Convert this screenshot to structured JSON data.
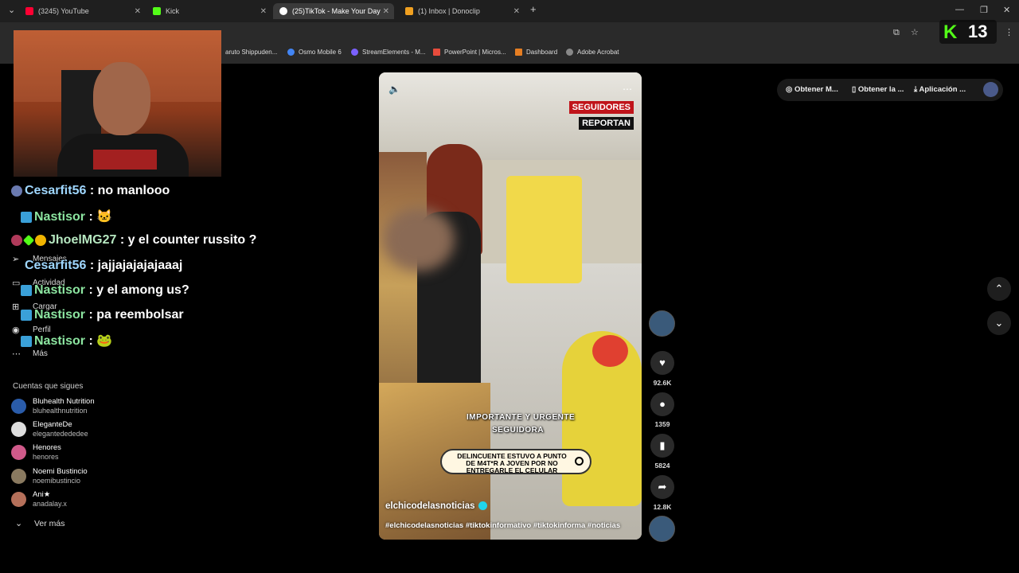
{
  "browser": {
    "tabs": [
      {
        "label": "(3245) YouTube",
        "color": "#ff0033"
      },
      {
        "label": "Kick",
        "color": "#53fc18"
      },
      {
        "label": "(25)TikTok - Make Your Day",
        "color": "#ffffff"
      },
      {
        "label": "(1) Inbox | Donoclip",
        "color": "#f0a020"
      }
    ],
    "new_tab": "+",
    "bookmarks": [
      {
        "label": "aruto Shippuden...",
        "color": "#555555"
      },
      {
        "label": "Osmo Mobile 6",
        "color": "#4285f4"
      },
      {
        "label": "StreamElements - M...",
        "color": "#7b61ff"
      },
      {
        "label": "PowerPoint | Micros...",
        "color": "#e74c3c"
      },
      {
        "label": "Dashboard",
        "color": "#e67e22"
      },
      {
        "label": "Adobe Acrobat",
        "color": "#888888"
      }
    ]
  },
  "stream": {
    "kick_label": "K",
    "kick_count": "13",
    "chat": [
      {
        "user": "Cesarfit56",
        "text": ": no manlooo",
        "style": "blue"
      },
      {
        "user": "Nastisor",
        "text": ":",
        "style": "green",
        "emote": "🐱"
      },
      {
        "user": "JhoelMG27",
        "text": ": y el counter russito ?",
        "style": "yellow"
      },
      {
        "user": "Cesarfit56",
        "text": ": jajjajajajajaaaj",
        "style": "blue"
      },
      {
        "user": "Nastisor",
        "text": ": y el among us?",
        "style": "green"
      },
      {
        "user": "Nastisor",
        "text": ": pa reembolsar",
        "style": "green"
      },
      {
        "user": "Nastisor",
        "text": ":",
        "style": "green",
        "emote": "🐸"
      }
    ]
  },
  "sidebar": {
    "items": [
      {
        "label": "Mensajes",
        "icon": "send-icon"
      },
      {
        "label": "Actividad",
        "icon": "inbox-icon"
      },
      {
        "label": "Cargar",
        "icon": "plus-icon"
      },
      {
        "label": "Perfil",
        "icon": "profile-icon"
      },
      {
        "label": "Más",
        "icon": "more-icon"
      }
    ],
    "following_title": "Cuentas que sigues",
    "accounts": [
      {
        "name": "Bluhealth Nutrition",
        "handle": "bluhealthnutrition",
        "color": "#2a5caa"
      },
      {
        "name": "EleganteDe",
        "handle": "elegantedededee",
        "color": "#dddddd"
      },
      {
        "name": "Henores",
        "handle": "henores",
        "color": "#d05a8a"
      },
      {
        "name": "Noemi Bustincio",
        "handle": "noemibustincio",
        "color": "#8a7a60"
      },
      {
        "name": "Ani★",
        "handle": "anadalay.x",
        "color": "#b5705a"
      }
    ],
    "see_more": "Ver más"
  },
  "video": {
    "brand_top": "SEGUIDORES",
    "brand_bottom": "REPORTAN",
    "caption1": "IMPORTANTE Y URGENTE",
    "caption2": "SEGUIDORA",
    "pill_line1": "DELINCUENTE ESTUVO A PUNTO",
    "pill_line2": "DE M4T*R A JOVEN POR NO",
    "pill_line3": "ENTREGARLE EL CELULAR",
    "username": "elchicodelasnoticias",
    "hashtags": "#elchicodelasnoticias #tiktokinformativo #tiktokinforma #noticias"
  },
  "actions": {
    "likes": "92.6K",
    "comments": "1359",
    "saves": "5824",
    "shares": "12.8K"
  },
  "top_buttons": {
    "coins": "Obtener M...",
    "app": "Obtener la ...",
    "desktop": "Aplicación ..."
  }
}
